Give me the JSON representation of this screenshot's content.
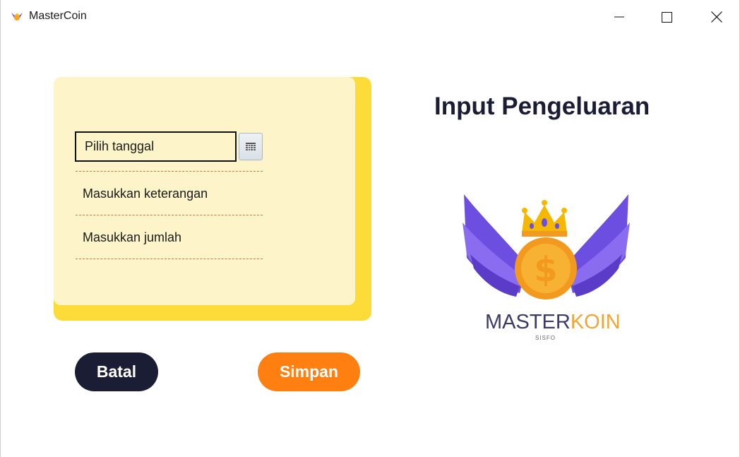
{
  "window": {
    "title": "MasterCoin",
    "controls": [
      "minimize-icon",
      "maximize-icon",
      "close-icon"
    ]
  },
  "form": {
    "date": {
      "placeholder": "Pilih tanggal",
      "value": ""
    },
    "calendar_button_icon": "calendar-icon",
    "description": {
      "placeholder": "Masukkan keterangan",
      "value": ""
    },
    "amount": {
      "placeholder": "Masukkan jumlah",
      "value": ""
    }
  },
  "buttons": {
    "cancel": "Batal",
    "save": "Simpan"
  },
  "header": {
    "title": "Input Pengeluaran"
  },
  "logo": {
    "brand_part1": "MASTER",
    "brand_part2": "KOIN",
    "subtitle": "SISFO",
    "icon": "winged-coin-crown-logo"
  },
  "colors": {
    "card": "#fdf5c9",
    "card_shadow": "#fddc3a",
    "cancel_button": "#1b1d35",
    "save_button": "#ff7f11",
    "title_text": "#1b1d35",
    "dashed_line": "#c9764a",
    "logo_wings": "#6c4ee0",
    "logo_coin": "#f5a623"
  }
}
